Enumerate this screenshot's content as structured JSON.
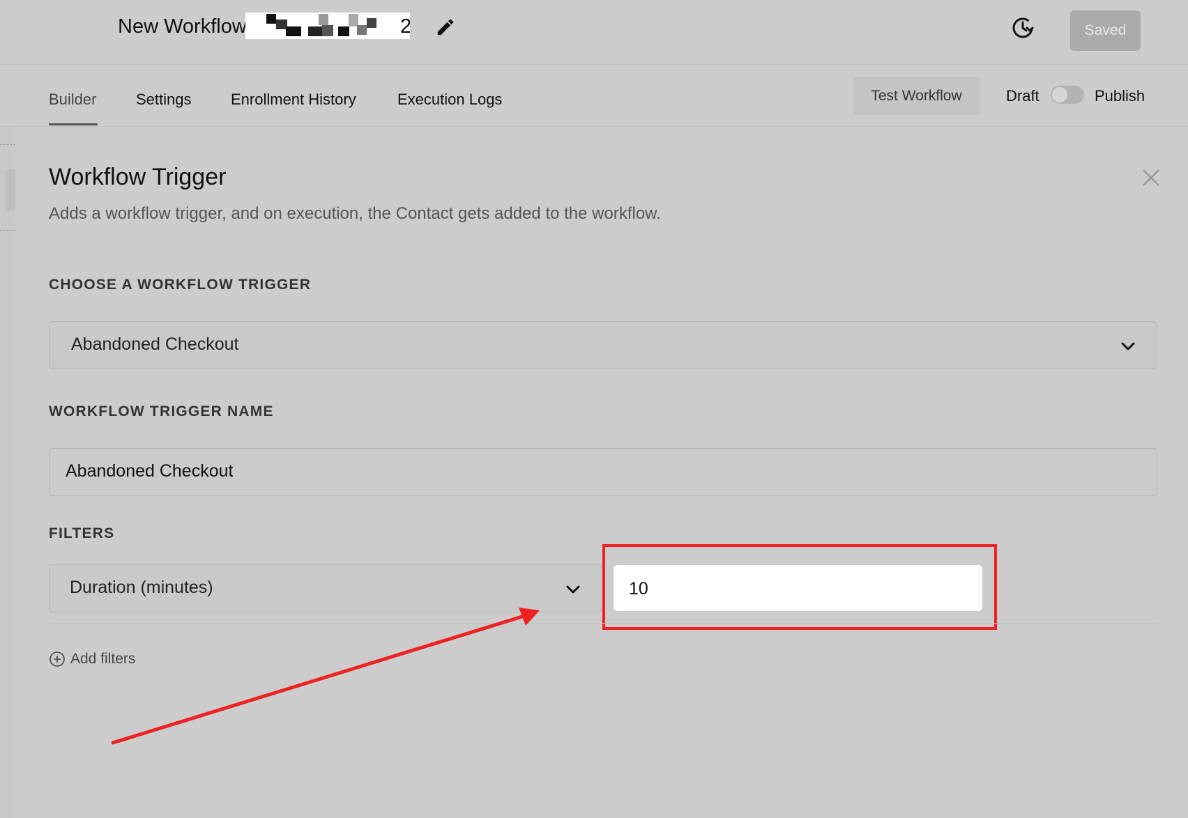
{
  "header": {
    "title": "New Workflow",
    "title_suffix": "2",
    "saved_label": "Saved"
  },
  "tabs": [
    {
      "label": "Builder",
      "active": true
    },
    {
      "label": "Settings"
    },
    {
      "label": "Enrollment History"
    },
    {
      "label": "Execution Logs"
    }
  ],
  "toolbar": {
    "test_label": "Test Workflow",
    "draft_label": "Draft",
    "publish_label": "Publish",
    "published": false
  },
  "panel": {
    "title": "Workflow Trigger",
    "description": "Adds a workflow trigger, and on execution, the Contact gets added to the workflow.",
    "choose_label": "CHOOSE A WORKFLOW TRIGGER",
    "trigger_value": "Abandoned Checkout",
    "name_label": "WORKFLOW TRIGGER NAME",
    "name_value": "Abandoned Checkout",
    "filters_label": "FILTERS",
    "filter_field": "Duration (minutes)",
    "filter_value": "10",
    "add_filters_label": "Add filters"
  },
  "colors": {
    "annotation": "#ee2222",
    "background": "#cccccc"
  }
}
